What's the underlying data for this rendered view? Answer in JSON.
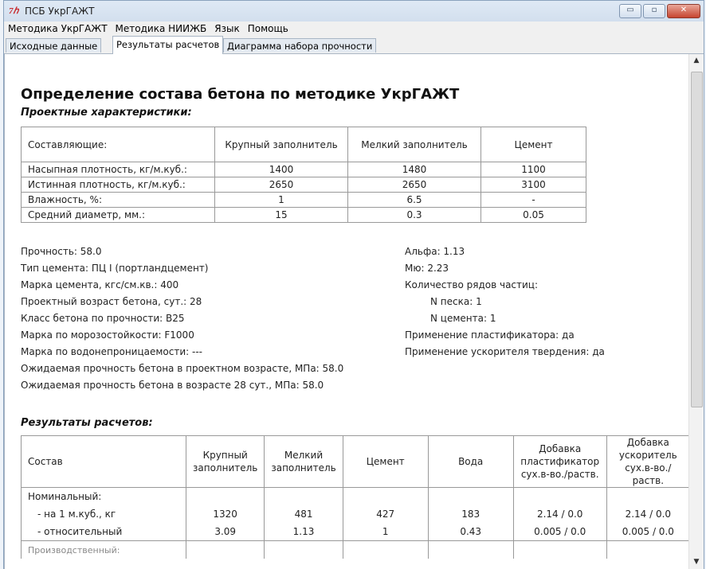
{
  "window": {
    "title": "ПСБ УкрГАЖТ",
    "icon_text": "7ℎ",
    "minimize": "▭",
    "maximize": "▫",
    "close": "✕"
  },
  "menu": [
    "Методика УкрГАЖТ",
    "Методика НИИЖБ",
    "Язык",
    "Помощь"
  ],
  "tabs": [
    "Исходные данные",
    "Результаты расчетов",
    "Диаграмма набора прочности"
  ],
  "active_tab": 1,
  "page": {
    "title": "Определение состава бетона по методике УкрГАЖТ",
    "design_section": "Проектные характеристики:",
    "results_section": "Результаты расчетов:"
  },
  "materials_table": {
    "headers": [
      "Составляющие:",
      "Крупный заполнитель",
      "Мелкий заполнитель",
      "Цемент"
    ],
    "rows": [
      [
        "Насыпная плотность, кг/м.куб.:",
        "1400",
        "1480",
        "1100"
      ],
      [
        "Истинная плотность, кг/м.куб.:",
        "2650",
        "2650",
        "3100"
      ],
      [
        "Влажность, %:",
        "1",
        "6.5",
        "-"
      ],
      [
        "Средний диаметр, мм.:",
        "15",
        "0.3",
        "0.05"
      ]
    ]
  },
  "left_props": [
    "Прочность: 58.0",
    "Тип цемента: ПЦ I (портландцемент)",
    "Марка цемента, кгс/см.кв.: 400",
    "Проектный возраст бетона, сут.: 28",
    "Класс бетона по прочности: B25",
    "Марка по морозостойкости: F1000",
    "Марка по водонепроницаемости: ---",
    "Ожидаемая прочность бетона в проектном возрасте, МПа: 58.0",
    "Ожидаемая прочность бетона в возрасте 28 сут., МПа: 58.0"
  ],
  "right_props": [
    "Альфа: 1.13",
    "Мю: 2.23",
    "Количество рядов частиц:",
    "N песка: 1",
    "N цемента: 1",
    "Применение пластификатора: да",
    "Применение ускорителя твердения: да"
  ],
  "results_table": {
    "headers": [
      "Состав",
      "Крупный заполнитель",
      "Мелкий заполнитель",
      "Цемент",
      "Вода",
      "Добавка пластификатор сух.в-во./раств.",
      "Добавка ускоритель сух.в-во./раств."
    ],
    "group1": "Номинальный:",
    "rows": [
      [
        "- на 1 м.куб., кг",
        "1320",
        "481",
        "427",
        "183",
        "2.14 / 0.0",
        "2.14 / 0.0"
      ],
      [
        "- относительный",
        "3.09",
        "1.13",
        "1",
        "0.43",
        "0.005 / 0.0",
        "0.005 / 0.0"
      ]
    ],
    "group2": "Производственный:"
  },
  "scrollbar": {
    "up": "▲",
    "down": "▼"
  }
}
